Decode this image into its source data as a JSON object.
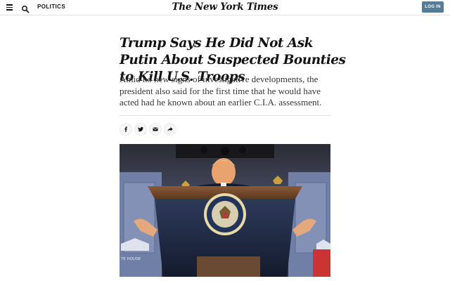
{
  "header": {
    "menu_icon": "hamburger-menu-icon",
    "search_icon": "search-icon",
    "section": "POLITICS",
    "masthead": "The New York Times",
    "login_label": "LOG IN",
    "login_color": "#567b95"
  },
  "article": {
    "headline": "Trump Says He Did Not Ask Putin About Suspected Bounties to Kill U.S. Troops",
    "summary": "Amid no new signs of investigative developments, the president also said for the first time that he would have acted had he known about an earlier C.I.A. assessment.",
    "share_icons": [
      "facebook-icon",
      "twitter-icon",
      "email-icon",
      "share-arrow-icon"
    ],
    "photo_caption_sign": "WHITE HOUSE"
  }
}
